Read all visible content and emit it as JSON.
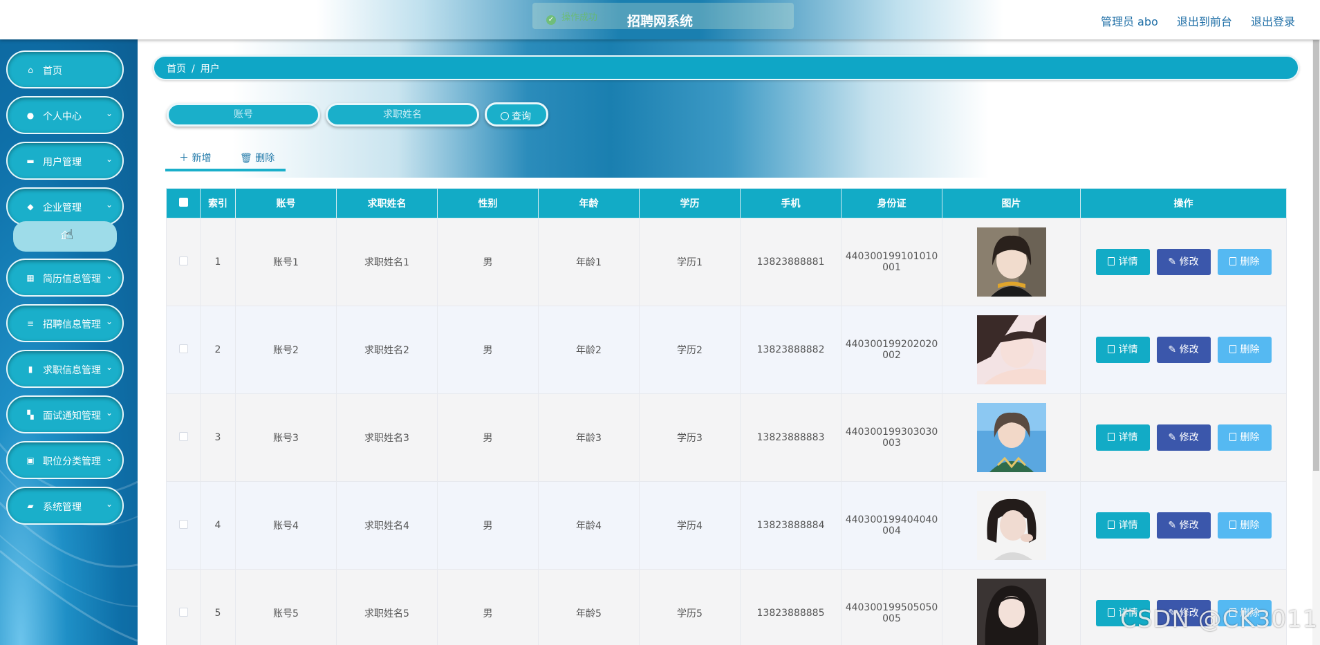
{
  "header": {
    "title": "招聘网系统",
    "toast": "操作成功",
    "user": "管理员 abo",
    "to_front": "退出到前台",
    "logout": "退出登录"
  },
  "sidebar": {
    "items": [
      {
        "label": "首页",
        "icon": "home-icon",
        "arrow": false
      },
      {
        "label": "个人中心",
        "icon": "user-icon",
        "arrow": true
      },
      {
        "label": "用户管理",
        "icon": "briefcase-icon",
        "arrow": true
      },
      {
        "label": "企业管理",
        "icon": "location-icon",
        "arrow": true
      },
      {
        "label": "简历信息管理",
        "icon": "grid-icon",
        "arrow": true
      },
      {
        "label": "招聘信息管理",
        "icon": "list-icon",
        "arrow": true
      },
      {
        "label": "求职信息管理",
        "icon": "chart-icon",
        "arrow": true
      },
      {
        "label": "面试通知管理",
        "icon": "menu-icon",
        "arrow": true
      },
      {
        "label": "职位分类管理",
        "icon": "picture-icon",
        "arrow": true
      },
      {
        "label": "系统管理",
        "icon": "message-icon",
        "arrow": true
      }
    ],
    "submenu_label": "企"
  },
  "breadcrumb": {
    "home": "首页",
    "current": "用户"
  },
  "search": {
    "account_placeholder": "账号",
    "name_placeholder": "求职姓名",
    "query_label": "查询"
  },
  "actions": {
    "add": "新增",
    "delete": "删除"
  },
  "table": {
    "columns": [
      "索引",
      "账号",
      "求职姓名",
      "性别",
      "年龄",
      "学历",
      "手机",
      "身份证",
      "图片",
      "操作"
    ],
    "buttons": {
      "detail": "详情",
      "edit": "修改",
      "delete": "删除"
    },
    "rows": [
      {
        "index": "1",
        "account": "账号1",
        "name": "求职姓名1",
        "gender": "男",
        "age": "年龄1",
        "edu": "学历1",
        "phone": "13823888881",
        "id_a": "440300199101010",
        "id_b": "001"
      },
      {
        "index": "2",
        "account": "账号2",
        "name": "求职姓名2",
        "gender": "男",
        "age": "年龄2",
        "edu": "学历2",
        "phone": "13823888882",
        "id_a": "440300199202020",
        "id_b": "002"
      },
      {
        "index": "3",
        "account": "账号3",
        "name": "求职姓名3",
        "gender": "男",
        "age": "年龄3",
        "edu": "学历3",
        "phone": "13823888883",
        "id_a": "440300199303030",
        "id_b": "003"
      },
      {
        "index": "4",
        "account": "账号4",
        "name": "求职姓名4",
        "gender": "男",
        "age": "年龄4",
        "edu": "学历4",
        "phone": "13823888884",
        "id_a": "440300199404040",
        "id_b": "004"
      },
      {
        "index": "5",
        "account": "账号5",
        "name": "求职姓名5",
        "gender": "男",
        "age": "年龄5",
        "edu": "学历5",
        "phone": "13823888885",
        "id_a": "440300199505050",
        "id_b": "005"
      }
    ]
  },
  "watermark": "CSDN @CK3011",
  "colors": {
    "accent": "#12abc6",
    "edit": "#3b57ab",
    "delete": "#55b9f2",
    "sidebar": "#0e6fa8"
  }
}
